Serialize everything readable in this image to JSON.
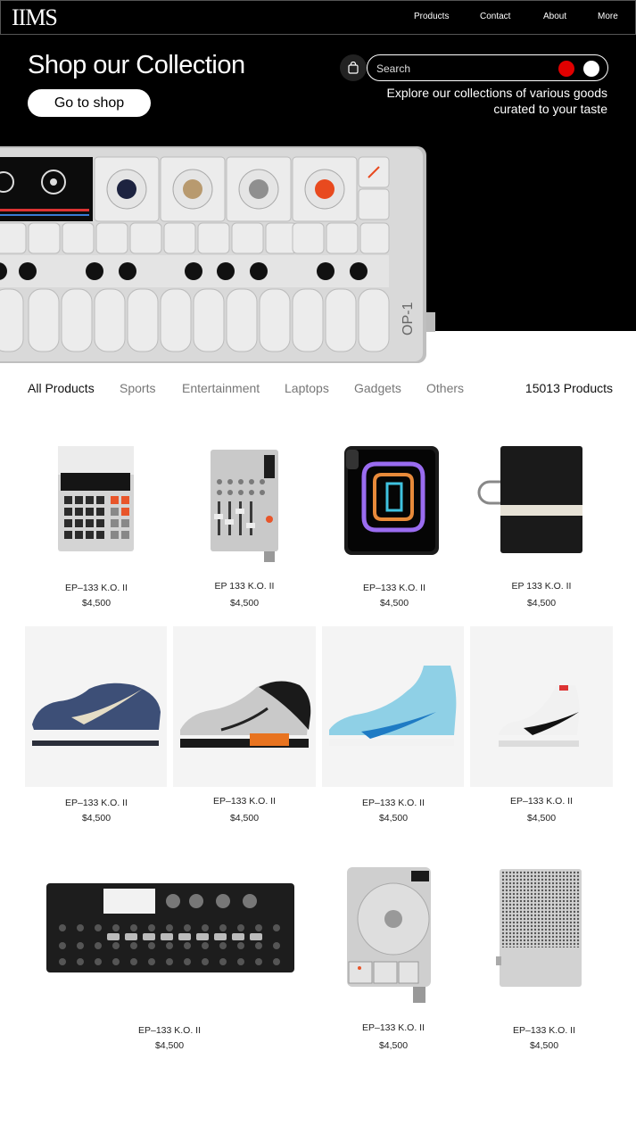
{
  "nav": {
    "logo": "IIMS",
    "links": [
      "Products",
      "Contact",
      "About",
      "More"
    ]
  },
  "hero": {
    "title": "Shop our Collection",
    "cta": "Go to shop",
    "search_placeholder": "Search",
    "subtitle_line1": "Explore our collections of various goods",
    "subtitle_line2": "curated to your taste",
    "synth_label": "OP-1"
  },
  "categories": [
    "All Products",
    "Sports",
    "Entertainment",
    "Laptops",
    "Gadgets",
    "Others"
  ],
  "product_count": "15013 Products",
  "products": [
    {
      "name": "EP–133 K.O. II",
      "price": "$4,500"
    },
    {
      "name": "EP 133 K.O. II",
      "price": "$4,500"
    },
    {
      "name": "EP–133 K.O. II",
      "price": "$4,500"
    },
    {
      "name": "EP 133 K.O. II",
      "price": "$4,500"
    },
    {
      "name": "EP–133 K.O. II",
      "price": "$4,500"
    },
    {
      "name": "EP–133 K.O. II",
      "price": "$4,500"
    },
    {
      "name": "EP–133 K.O. II",
      "price": "$4,500"
    },
    {
      "name": "EP–133 K.O. II",
      "price": "$4,500"
    },
    {
      "name": "EP–133 K.O. II",
      "price": "$4,500"
    },
    {
      "name": "EP–133 K.O. II",
      "price": "$4,500"
    },
    {
      "name": "EP–133 K.O. II",
      "price": "$4,500"
    }
  ],
  "colors": {
    "accent_red": "#e00000",
    "accent_white": "#ffffff",
    "background_dark": "#000000"
  }
}
